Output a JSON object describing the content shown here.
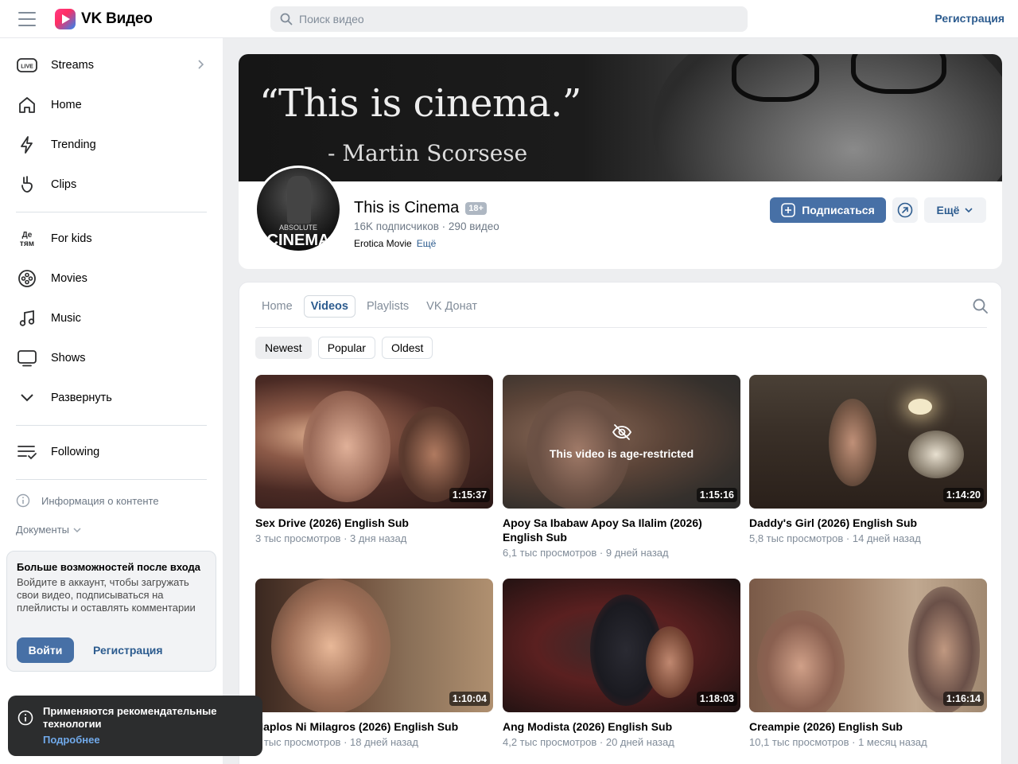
{
  "header": {
    "logo_text": "VK Видео",
    "search_placeholder": "Поиск видео",
    "register_label": "Регистрация"
  },
  "sidebar": {
    "items": [
      {
        "label": "Streams",
        "icon": "live-icon"
      },
      {
        "label": "Home",
        "icon": "home-icon"
      },
      {
        "label": "Trending",
        "icon": "lightning-icon"
      },
      {
        "label": "Clips",
        "icon": "clips-icon"
      },
      {
        "label": "For kids",
        "icon": "kids-icon"
      },
      {
        "label": "Movies",
        "icon": "film-reel-icon"
      },
      {
        "label": "Music",
        "icon": "music-note-icon"
      },
      {
        "label": "Shows",
        "icon": "tv-icon"
      },
      {
        "label": "Развернуть",
        "icon": "chevron-down-icon"
      },
      {
        "label": "Following",
        "icon": "subscriptions-icon"
      }
    ],
    "info_label": "Информация о контенте",
    "docs_label": "Документы",
    "login_card": {
      "title": "Больше возможностей после входа",
      "text": "Войдите в аккаунт, чтобы загружать свои видео, подписываться на плейлисты и оставлять комментарии",
      "login_button": "Войти",
      "register_link": "Регистрация"
    }
  },
  "toast": {
    "text": "Применяются рекомендательные технологии",
    "link": "Подробнее"
  },
  "channel": {
    "banner_quote": "“This is cinema.”",
    "banner_author": "- Martin Scorsese",
    "avatar_text_top": "ABSOLUTE",
    "avatar_text_bottom": "CINEMA",
    "name": "This is Cinema",
    "age_badge": "18+",
    "stats": "16K подписчиков · 290 видео",
    "description": "Erotica Movie",
    "description_more": "Ещё",
    "subscribe_label": "Подписаться",
    "more_label": "Ещё"
  },
  "tabs": [
    {
      "label": "Home",
      "active": false
    },
    {
      "label": "Videos",
      "active": true
    },
    {
      "label": "Playlists",
      "active": false
    },
    {
      "label": "VK Донат",
      "active": false
    }
  ],
  "sort": [
    {
      "label": "Newest",
      "active": true
    },
    {
      "label": "Popular",
      "active": false
    },
    {
      "label": "Oldest",
      "active": false
    }
  ],
  "videos": [
    {
      "title": "Sex Drive (2026) English Sub",
      "meta": "3 тыс просмотров · 3 дня назад",
      "duration": "1:15:37",
      "restricted": false
    },
    {
      "title": "Apoy Sa Ibabaw Apoy Sa Ilalim (2026) English Sub",
      "meta": "6,1 тыс просмотров · 9 дней назад",
      "duration": "1:15:16",
      "restricted": true,
      "restricted_text": "This video is age-restricted"
    },
    {
      "title": "Daddy's Girl (2026) English Sub",
      "meta": "5,8 тыс просмотров · 14 дней назад",
      "duration": "1:14:20",
      "restricted": false
    },
    {
      "title": "Haplos Ni Milagros (2026) English Sub",
      "meta": "6 тыс просмотров · 18 дней назад",
      "duration": "1:10:04",
      "restricted": false
    },
    {
      "title": "Ang Modista (2026) English Sub",
      "meta": "4,2 тыс просмотров · 20 дней назад",
      "duration": "1:18:03",
      "restricted": false
    },
    {
      "title": "Creampie (2026) English Sub",
      "meta": "10,1 тыс просмотров · 1 месяц назад",
      "duration": "1:16:14",
      "restricted": false
    }
  ],
  "colors": {
    "accent": "#4770a6",
    "link": "#2d5c8f",
    "background": "#edeef0"
  }
}
